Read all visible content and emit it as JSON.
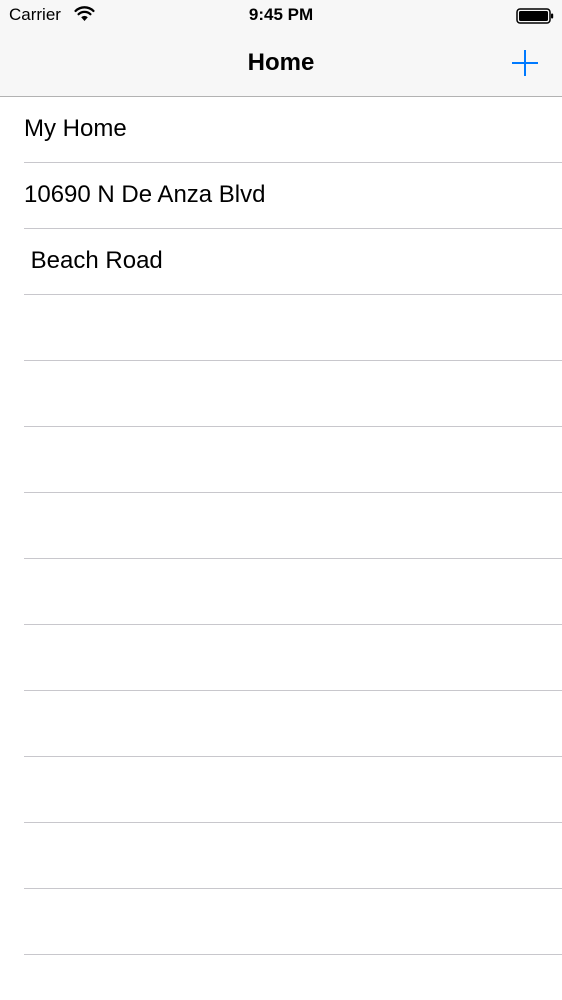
{
  "status_bar": {
    "carrier": "Carrier",
    "time": "9:45 PM",
    "wifi_icon": "wifi-icon",
    "battery_icon": "battery-icon"
  },
  "nav": {
    "title": "Home",
    "add_icon": "plus-icon",
    "accent_color": "#007aff"
  },
  "table": {
    "rows": [
      {
        "label": "My Home"
      },
      {
        "label": "10690 N De Anza Blvd"
      },
      {
        "label": " Beach Road"
      },
      {
        "label": ""
      },
      {
        "label": ""
      },
      {
        "label": ""
      },
      {
        "label": ""
      },
      {
        "label": ""
      },
      {
        "label": ""
      },
      {
        "label": ""
      },
      {
        "label": ""
      },
      {
        "label": ""
      },
      {
        "label": ""
      },
      {
        "label": ""
      }
    ]
  }
}
